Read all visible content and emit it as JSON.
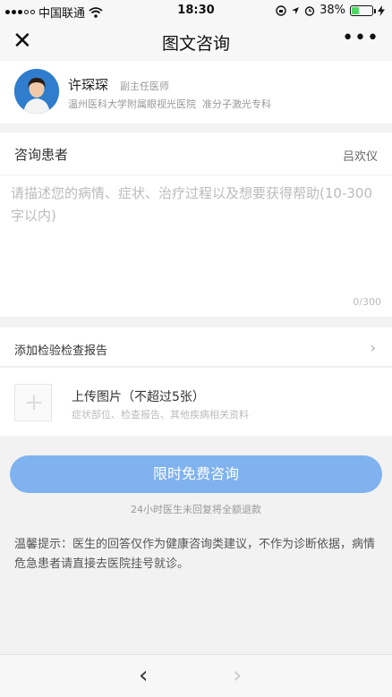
{
  "status_bar": {
    "carrier": "中国联通",
    "time": "18:30",
    "battery_percent": "38%",
    "battery_level": 0.38,
    "battery_color": "#4cd964",
    "icons": [
      "signal-dots-icon",
      "wifi-icon",
      "screen-lock-icon",
      "location-icon",
      "alarm-icon",
      "charging-icon"
    ]
  },
  "nav": {
    "title": "图文咨询",
    "close_glyph": "✕",
    "more_glyph": "•••"
  },
  "doctor": {
    "name": "许琛琛",
    "rank": "副主任医师",
    "hospital": "温州医科大学附属眼视光医院",
    "department": "准分子激光专科"
  },
  "patient": {
    "label": "咨询患者",
    "name": "吕欢仪",
    "description_placeholder": "请描述您的病情、症状、治疗过程以及想要获得帮助(10-300字以内)",
    "counter": "0/300"
  },
  "report": {
    "label": "添加检验检查报告",
    "chevron": "›"
  },
  "upload": {
    "title": "上传图片（不超过5张）",
    "subtitle": "症状部位、检查报告、其他疾病相关资料",
    "plus": "+"
  },
  "cta": {
    "label": "限时免费咨询",
    "note": "24小时医生未回复将全额退款",
    "color": "#7fb2ef"
  },
  "tip": "温馨提示：医生的回答仅作为健康咨询类建议，不作为诊断依据，病情危急患者请直接去医院挂号就诊。",
  "bottom_nav": {
    "back": "‹",
    "forward": "›"
  }
}
